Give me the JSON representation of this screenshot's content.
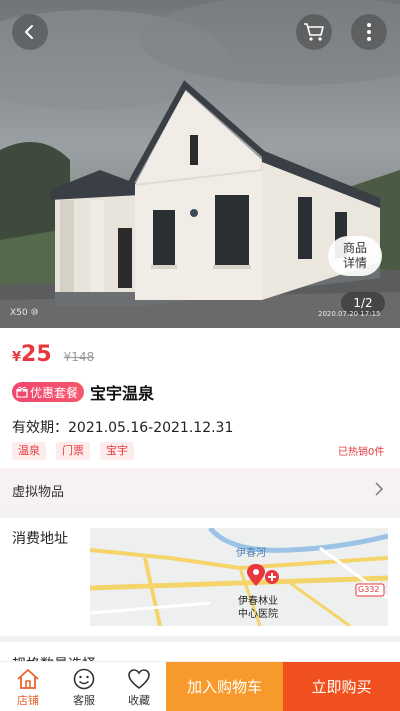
{
  "hero": {
    "pager": "1/2",
    "detail_label_1": "商品",
    "detail_label_2": "详情",
    "camera_mark": "X50 ⑩",
    "photo_stamp": "2020.07.20 17:15"
  },
  "product": {
    "currency": "¥",
    "price": "25",
    "original_price": "¥148",
    "badge": "优惠套餐",
    "title": "宝宇温泉",
    "validity": "有效期：2021.05.16-2021.12.31",
    "tags": [
      "温泉",
      "门票",
      "宝宇"
    ],
    "sold": "已热销0件"
  },
  "virtual": {
    "label": "虚拟物品"
  },
  "address": {
    "label": "消费地址",
    "map": {
      "river_label": "伊春河",
      "place_label_1": "伊春林业",
      "place_label_2": "中心医院",
      "road_badge": "G332"
    }
  },
  "spec": {
    "label": "规格数量选择"
  },
  "bottom_bar": {
    "shop": "店铺",
    "service": "客服",
    "favorite": "收藏",
    "add_to_cart": "加入购物车",
    "buy_now": "立即购买"
  },
  "colors": {
    "accent_red": "#e8383d",
    "orange": "#f79a2b",
    "buy_red": "#f1511f"
  },
  "icons": [
    "back-icon",
    "cart-icon",
    "more-icon",
    "gift-icon",
    "chevron-right-icon",
    "home-icon",
    "smile-icon",
    "heart-icon",
    "location-pin-icon"
  ]
}
